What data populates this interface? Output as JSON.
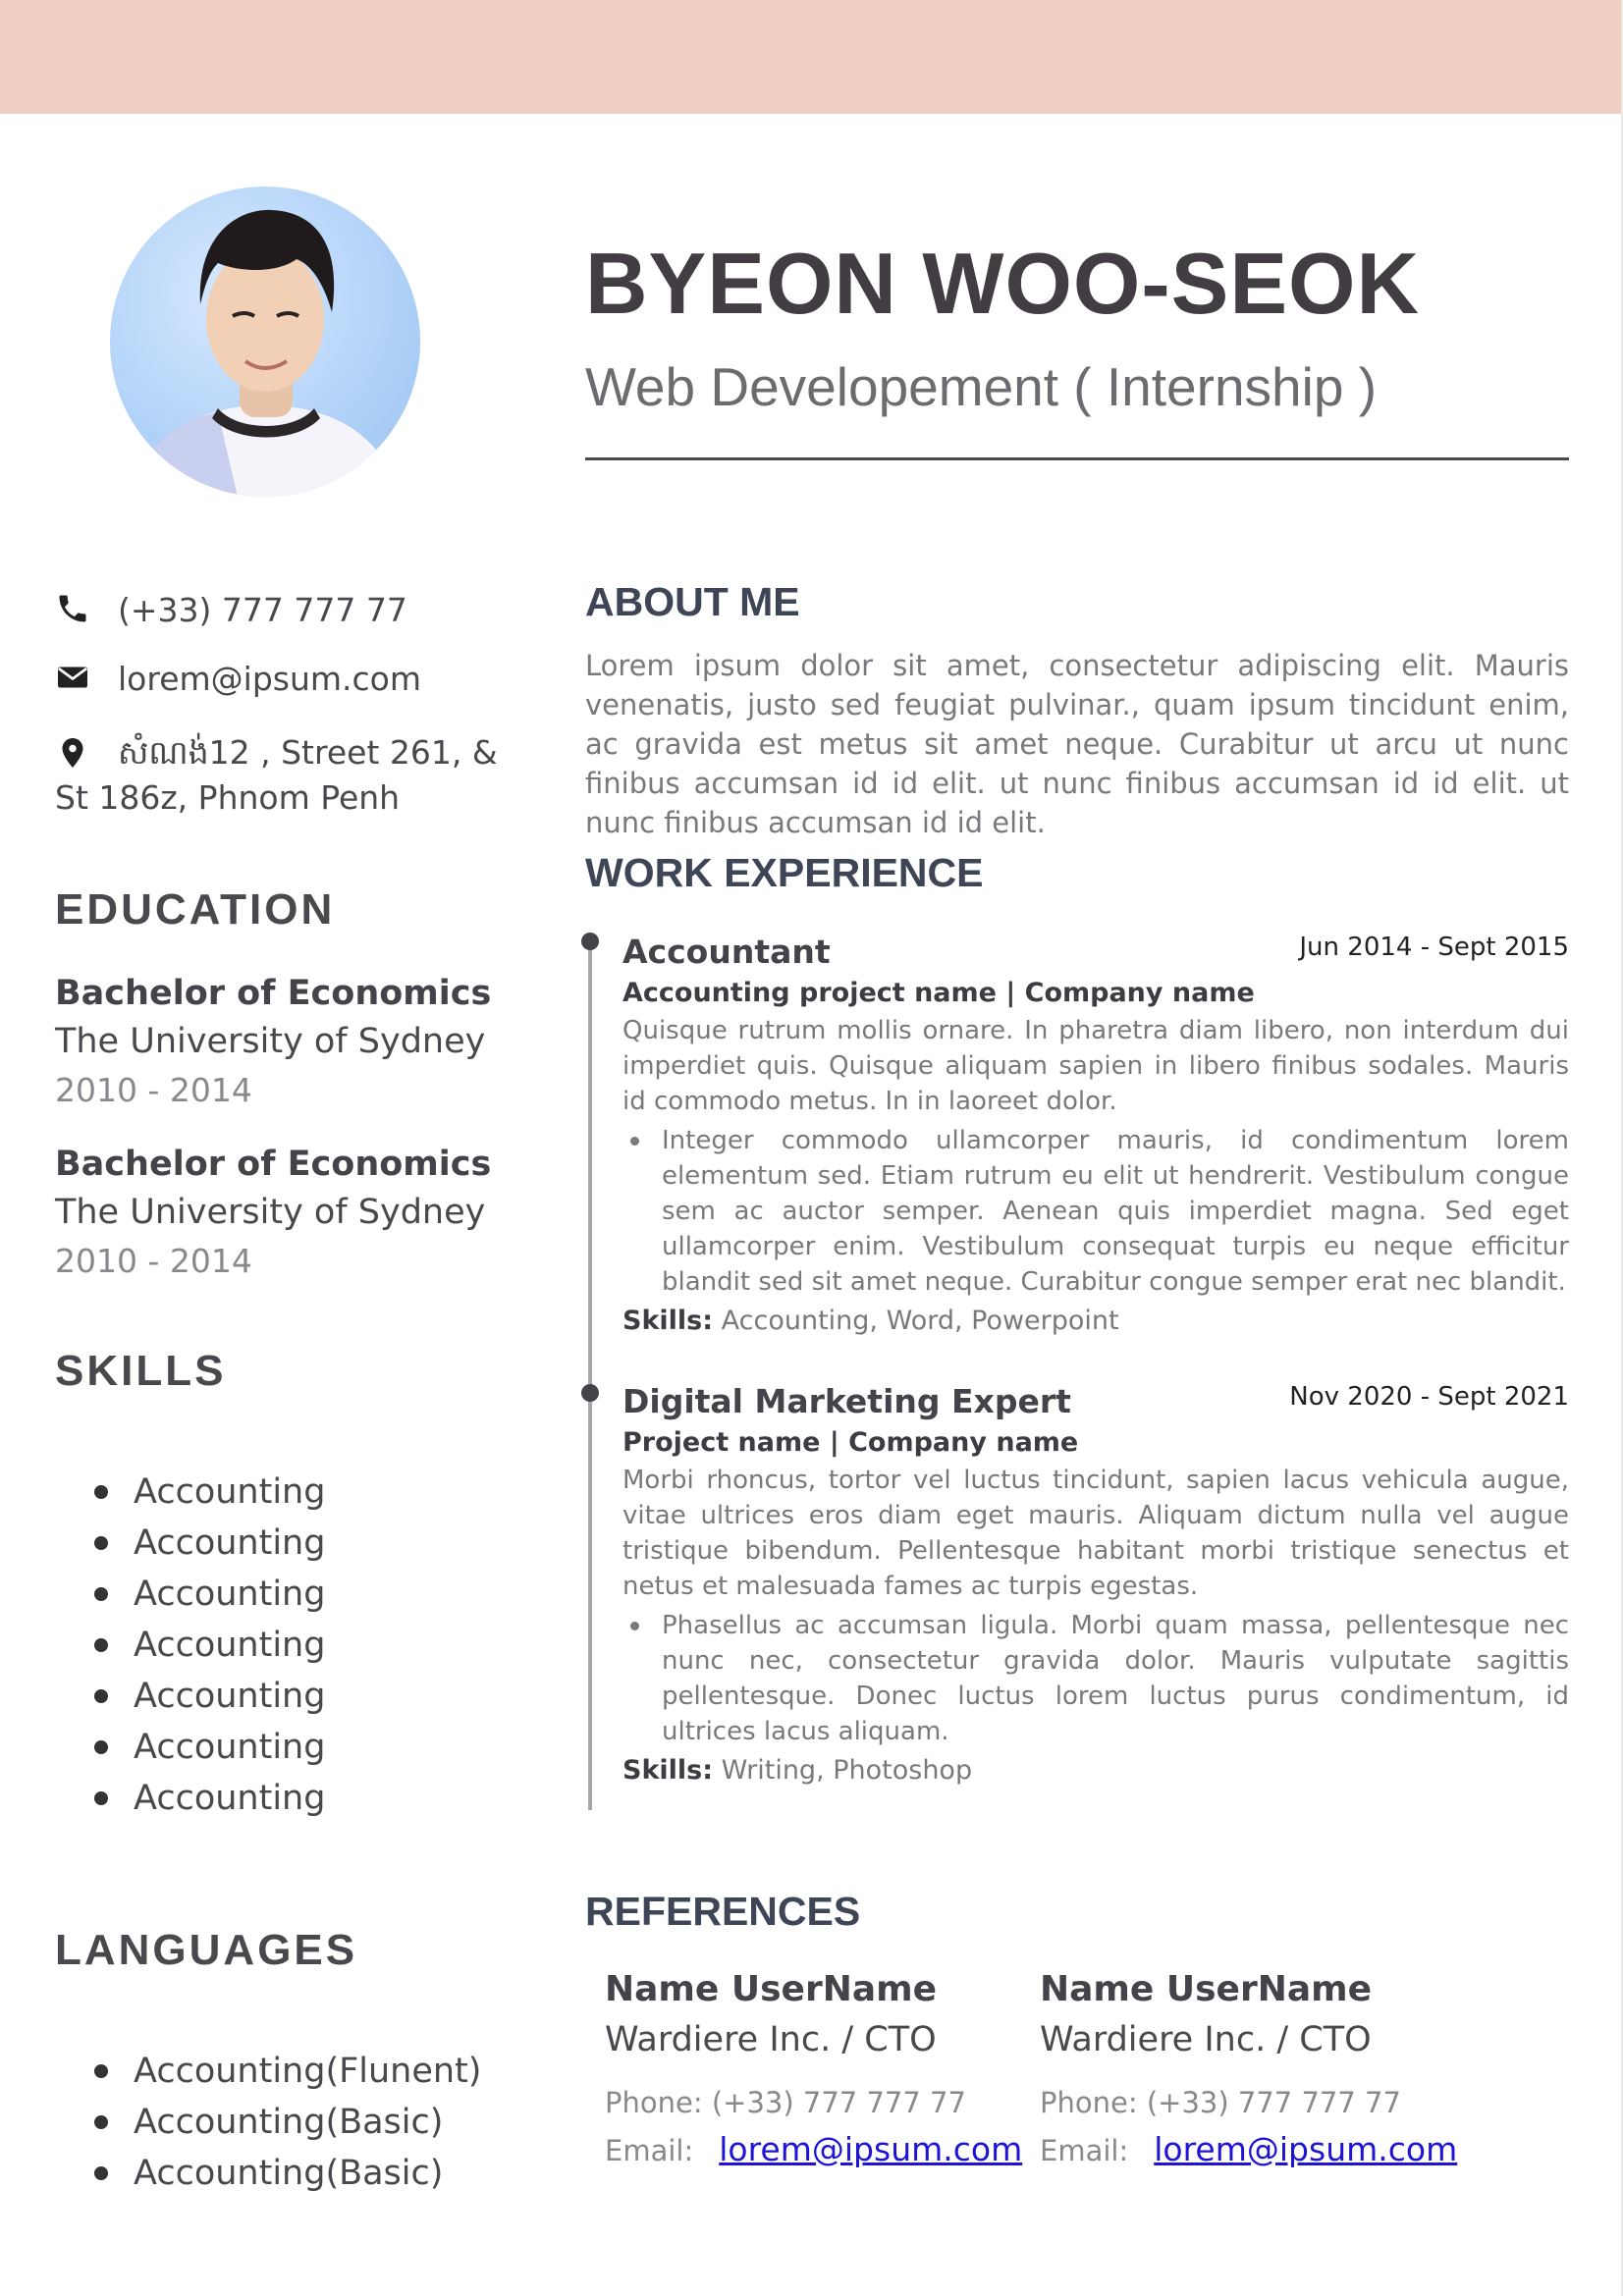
{
  "header": {
    "name": "BYEON WOO-SEOK",
    "role": "Web Developement ( Internship )"
  },
  "contact": {
    "phone": "(+33) 777 777 77",
    "email": "lorem@ipsum.com",
    "address_line1": "សំណង់12 , Street 261, &",
    "address_line2": "St 186z, Phnom Penh"
  },
  "education": {
    "heading": "EDUCATION",
    "items": [
      {
        "degree": "Bachelor of Economics",
        "school": "The University of Sydney",
        "years": "2010 - 2014"
      },
      {
        "degree": "Bachelor of Economics",
        "school": "The University of Sydney",
        "years": "2010 - 2014"
      }
    ]
  },
  "skills": {
    "heading": "SKILLS",
    "items": [
      "Accounting",
      "Accounting",
      "Accounting",
      "Accounting",
      "Accounting",
      "Accounting",
      "Accounting"
    ]
  },
  "languages": {
    "heading": "LANGUAGES",
    "items": [
      "Accounting(Flunent)",
      "Accounting(Basic)",
      "Accounting(Basic)"
    ]
  },
  "about": {
    "heading": "ABOUT ME",
    "text": "Lorem ipsum dolor sit amet, consectetur adipiscing elit. Mauris venenatis, justo sed feugiat pulvinar., quam ipsum tincidunt enim, ac gravida est metus sit amet neque. Curabitur ut arcu ut nunc finibus accumsan id id elit. ut nunc finibus accumsan id id elit. ut nunc finibus accumsan id id elit."
  },
  "work": {
    "heading": "WORK EXPERIENCE",
    "skills_label": "Skills:",
    "jobs": [
      {
        "title": "Accountant",
        "date": "Jun 2014 - Sept 2015",
        "subtitle": "Accounting project name | Company name",
        "description": "Quisque rutrum mollis ornare. In pharetra diam libero, non interdum dui imperdiet quis. Quisque aliquam sapien in libero finibus sodales. Mauris id commodo metus. In in laoreet dolor.",
        "bullet": "Integer commodo ullamcorper mauris, id condimentum lorem elementum sed. Etiam rutrum eu elit ut hendrerit. Vestibulum congue sem ac auctor semper. Aenean quis imperdiet magna. Sed eget ullamcorper enim. Vestibulum consequat turpis eu neque efficitur blandit sed sit amet neque. Curabitur congue semper erat nec blandit.",
        "skills": "Accounting, Word, Powerpoint"
      },
      {
        "title": "Digital Marketing Expert",
        "date": "Nov 2020 - Sept 2021",
        "subtitle": "Project name | Company name",
        "description": "Morbi rhoncus, tortor vel luctus tincidunt, sapien lacus vehicula augue, vitae ultrices eros diam eget mauris. Aliquam dictum nulla vel augue tristique bibendum. Pellentesque habitant morbi tristique senectus et netus et malesuada fames ac turpis egestas.",
        "bullet": "Phasellus ac accumsan ligula. Morbi quam massa, pellentesque nec nunc nec, consectetur gravida dolor. Mauris vulputate sagittis pellentesque. Donec luctus lorem luctus purus condimentum, id ultrices lacus aliquam.",
        "skills": "Writing, Photoshop"
      }
    ]
  },
  "references": {
    "heading": "REFERENCES",
    "phone_label": "Phone:",
    "email_label": "Email:",
    "items": [
      {
        "name": "Name UserName",
        "company": "Wardiere Inc. / CTO",
        "phone": "(+33) 777 777 77",
        "email": "lorem@ipsum.com"
      },
      {
        "name": "Name UserName",
        "company": "Wardiere Inc. / CTO",
        "phone": "(+33) 777 777 77",
        "email": "lorem@ipsum.com"
      }
    ]
  }
}
